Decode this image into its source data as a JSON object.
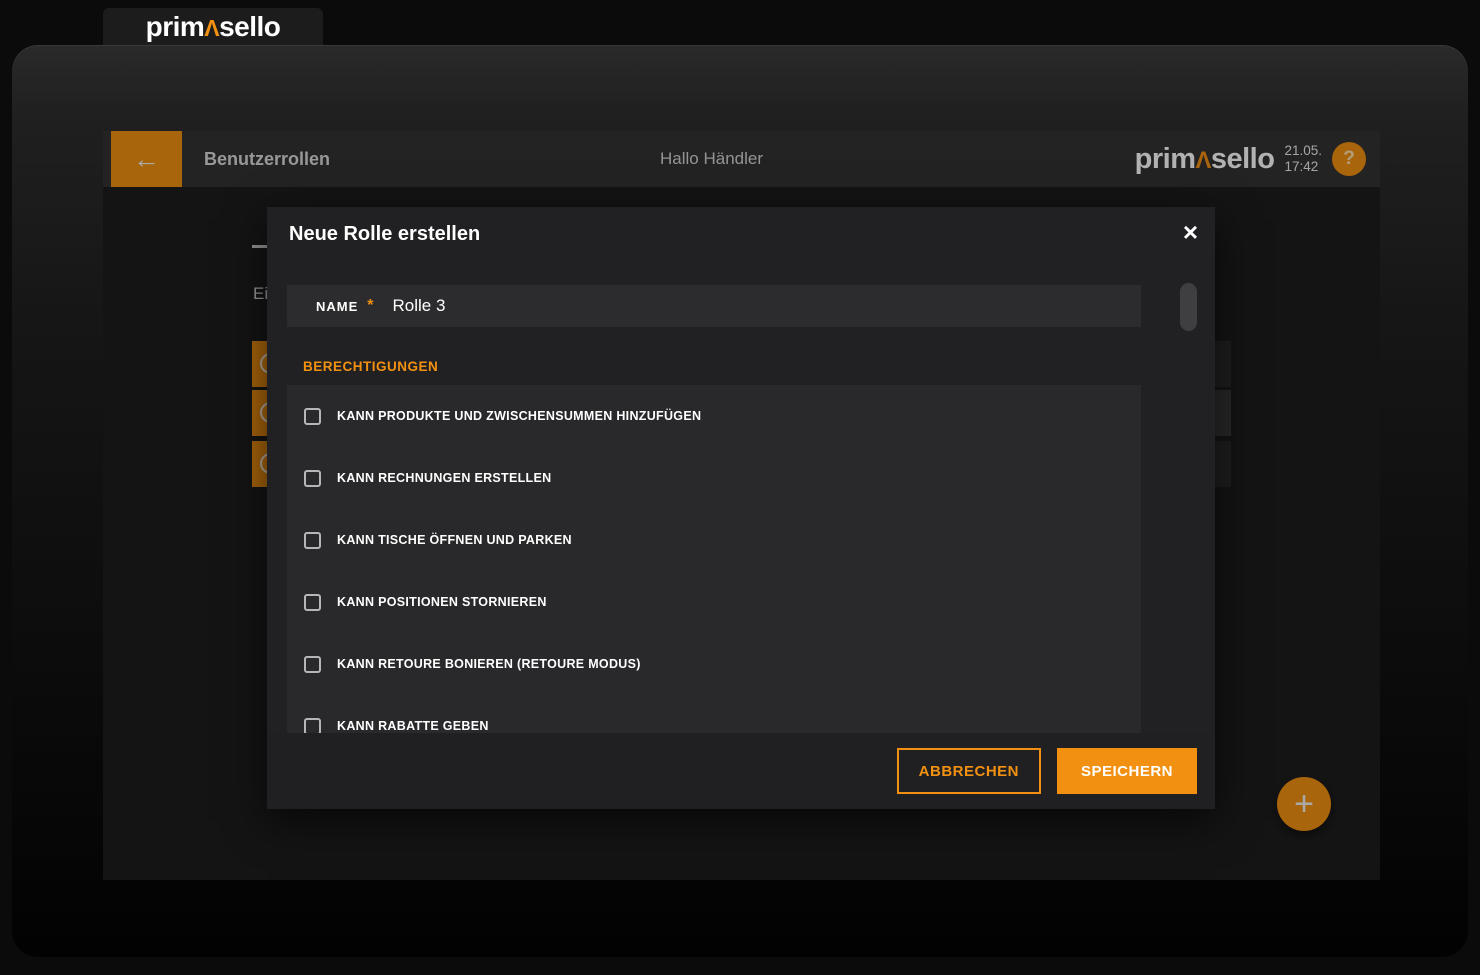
{
  "brand": {
    "logo_prefix": "prim",
    "logo_caret": "Λ",
    "logo_suffix": "sello"
  },
  "header": {
    "back_icon": "←",
    "title": "Benutzerrollen",
    "greeting": "Hallo Händler",
    "date": "21.05.",
    "time": "17:42",
    "help_icon": "?"
  },
  "page": {
    "truncated_text": "Ei"
  },
  "modal": {
    "title": "Neue Rolle erstellen",
    "close_icon": "×",
    "name_field": {
      "label": "NAME",
      "required_mark": "*",
      "value": "Rolle 3"
    },
    "permissions_heading": "BERECHTIGUNGEN",
    "permissions": [
      {
        "label": "KANN PRODUKTE UND ZWISCHENSUMMEN HINZUFÜGEN",
        "checked": false
      },
      {
        "label": "KANN RECHNUNGEN ERSTELLEN",
        "checked": false
      },
      {
        "label": "KANN TISCHE ÖFFNEN UND PARKEN",
        "checked": false
      },
      {
        "label": "KANN POSITIONEN STORNIEREN",
        "checked": false
      },
      {
        "label": "KANN RETOURE BONIEREN (RETOURE MODUS)",
        "checked": false
      },
      {
        "label": "KANN RABATTE GEBEN",
        "checked": false
      }
    ],
    "buttons": {
      "cancel": "ABBRECHEN",
      "save": "SPEICHERN"
    }
  },
  "fab": {
    "icon": "+"
  },
  "colors": {
    "accent": "#f29111",
    "modal_bg": "#212123",
    "page_bg": "#1e1e1e",
    "header_bg": "#333333"
  }
}
